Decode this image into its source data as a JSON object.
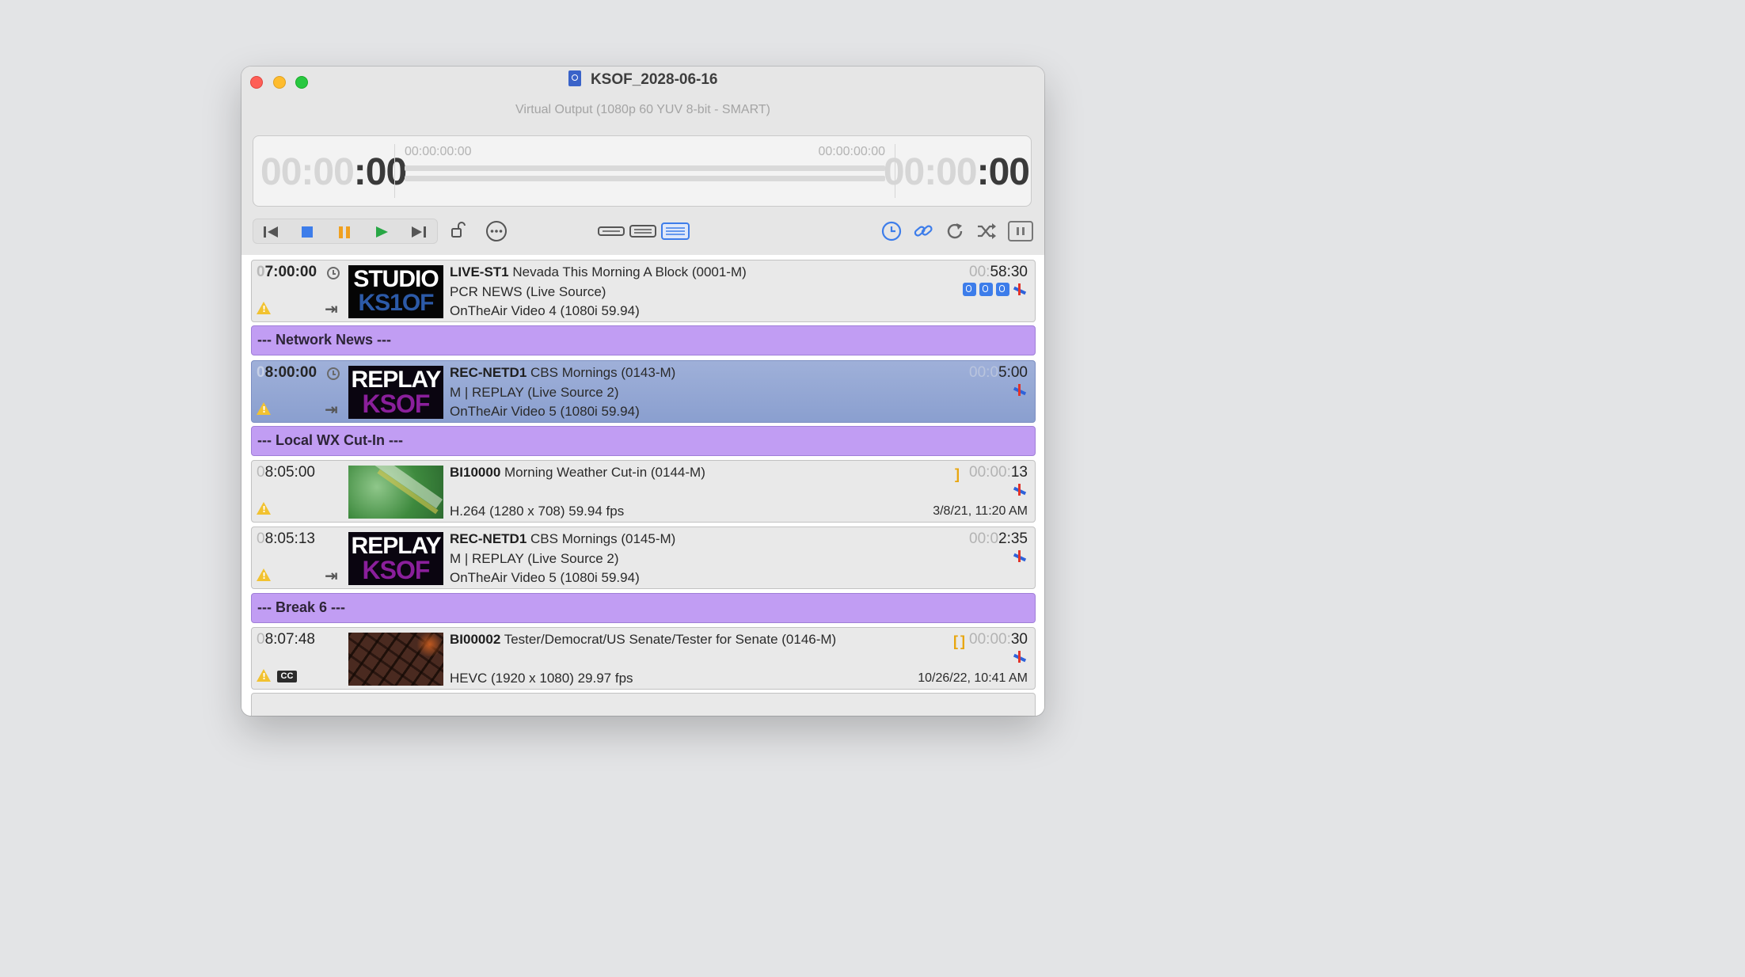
{
  "window": {
    "title": "KSOF_2028-06-16",
    "subtitle": "Virtual Output (1080p 60 YUV 8-bit - SMART)"
  },
  "timer": {
    "left_dim": "00:00",
    "left_strong": ":00",
    "right_dim": "00:00",
    "right_strong": ":00",
    "tc_start": "00:00:00:00",
    "tc_end": "00:00:00:00"
  },
  "toolbar": {
    "transport": [
      "skip-back-icon",
      "stop-icon",
      "pause-icon",
      "play-icon",
      "skip-forward-icon"
    ],
    "right_icons": [
      "clock-icon",
      "link-icon",
      "repeat-icon",
      "shuffle-icon",
      "pause-box-icon"
    ],
    "accent": "#3d7dea"
  },
  "items": [
    {
      "kind": "event",
      "time_dim": "0",
      "time": "7:00:00",
      "thumb_top": "STUDIO",
      "thumb_bottom": "KS1OF",
      "id": "LIVE-ST1",
      "name": "Nevada  This Morning A Block (0001-M)",
      "line2": "PCR NEWS (Live Source)",
      "line3": "OnTheAir Video 4 (1080i 59.94)",
      "dur_dim": "00:",
      "dur": "58:30"
    },
    {
      "kind": "header",
      "label": "--- Network News ---"
    },
    {
      "kind": "event",
      "time_dim": "0",
      "time": "8:00:00",
      "thumb_top": "REPLAY",
      "thumb_bottom": "KSOF",
      "id": "REC-NETD1",
      "name": "CBS Mornings (0143-M)",
      "line2": "M | REPLAY (Live Source 2)",
      "line3": "OnTheAir Video 5 (1080i 59.94)",
      "dur_dim": "00:0",
      "dur": "5:00"
    },
    {
      "kind": "header",
      "label": "--- Local WX Cut-In ---"
    },
    {
      "kind": "event",
      "time_dim": "0",
      "time": "8:05:00",
      "id": "BI10000",
      "name": "Morning Weather Cut-in (0144-M)",
      "line3": "H.264 (1280 x 708) 59.94 fps",
      "date": "3/8/21, 11:20 AM",
      "dur_dim": "00:00:",
      "dur": "13"
    },
    {
      "kind": "event",
      "time_dim": "0",
      "time": "8:05:13",
      "thumb_top": "REPLAY",
      "thumb_bottom": "KSOF",
      "id": "REC-NETD1",
      "name": "CBS Mornings (0145-M)",
      "line2": "M | REPLAY (Live Source 2)",
      "line3": "OnTheAir Video 5 (1080i 59.94)",
      "dur_dim": "00:0",
      "dur": "2:35"
    },
    {
      "kind": "header",
      "label": "--- Break 6 ---"
    },
    {
      "kind": "event",
      "time_dim": "0",
      "time": "8:07:48",
      "id": "BI00002",
      "name": "Tester/Democrat/US Senate/Tester for Senate (0146-M)",
      "line3": "HEVC (1920 x 1080) 29.97 fps",
      "date": "10/26/22, 10:41 AM",
      "dur_dim": "00:00:",
      "dur": "30",
      "cc": "CC"
    }
  ]
}
